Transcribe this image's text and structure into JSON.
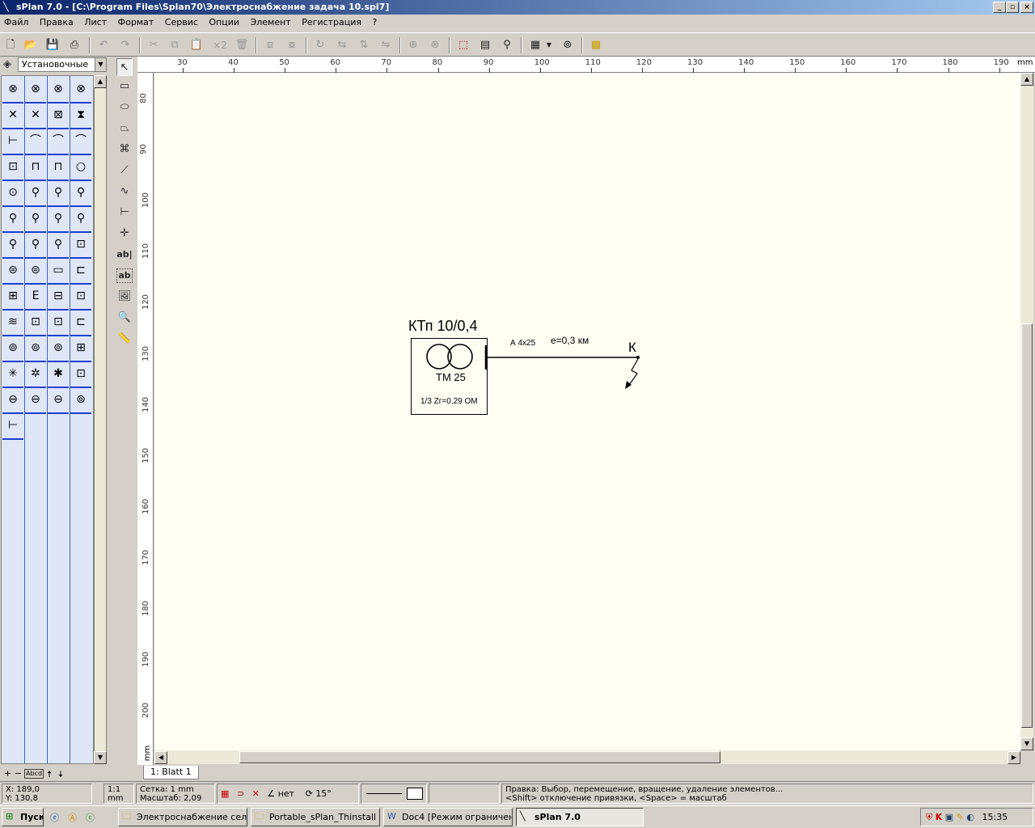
{
  "window": {
    "title": "sPlan 7.0 - [C:\\Program Files\\Splan70\\Электроснабжение задача 10.spl7]",
    "btn_min": "_",
    "btn_max": "▫",
    "btn_close": "×"
  },
  "menu": [
    "Файл",
    "Правка",
    "Лист",
    "Формат",
    "Сервис",
    "Опции",
    "Элемент",
    "Регистрация",
    "?"
  ],
  "toolbar": {
    "x2_label": "×2"
  },
  "library": {
    "selected": "Установочные",
    "footer_label": "Abcd"
  },
  "tools": {
    "text_tool": "ab|",
    "text_frame_tool": "ab"
  },
  "ruler": {
    "unit": "mm",
    "h_ticks": [
      "30",
      "40",
      "50",
      "60",
      "70",
      "80",
      "90",
      "100",
      "110",
      "120",
      "130",
      "140",
      "150",
      "160",
      "170",
      "180",
      "190"
    ],
    "v_ticks": [
      "80",
      "90",
      "100",
      "110",
      "120",
      "130",
      "140",
      "150",
      "160",
      "170",
      "180",
      "190",
      "200"
    ]
  },
  "schematic": {
    "transformer_title": "КТп 10/0,4",
    "transformer_model": "ТМ 25",
    "impedance": "1/3 Zг=0,29 ОМ",
    "cable": "А 4х25",
    "length": "е=0,3 км",
    "fault_point": "К"
  },
  "sheet_tab": "1: Blatt 1",
  "status": {
    "x": "X: 189,0",
    "y": "Y: 130,8",
    "scale_ratio": "1:1",
    "scale_unit": "mm",
    "grid": "Сетка: 1 mm",
    "zoom": "Масштаб:  2,09",
    "snap": "нет",
    "angle": "15°",
    "hint1": "Правка: Выбор, перемещение, вращение, удаление элементов...",
    "hint2": "<Shift> отключение привязки, <Space> = масштаб"
  },
  "taskbar": {
    "start": "Пуск",
    "tasks": [
      "Электроснабжение сел...",
      "Portable_sPlan_Thinstall",
      "Doc4 [Режим ограничен...",
      "sPlan 7.0"
    ],
    "clock": "15:35"
  }
}
